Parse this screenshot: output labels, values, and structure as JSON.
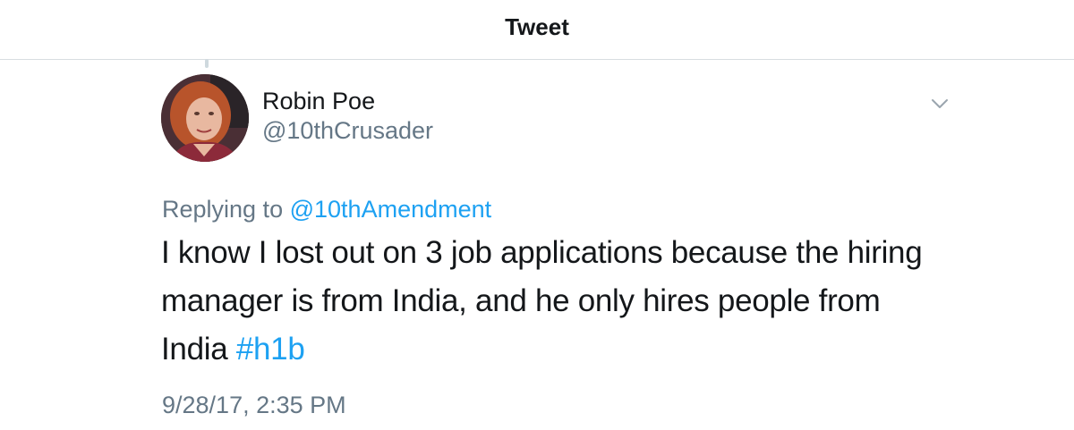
{
  "header": {
    "title": "Tweet"
  },
  "tweet": {
    "author": {
      "display_name": "Robin Poe",
      "handle": "@10thCrusader",
      "avatar_icon": "user-avatar-photo"
    },
    "menu_icon": "chevron-down-icon",
    "replying_to": {
      "prefix": "Replying to",
      "mention": "@10thAmendment"
    },
    "text_lines": [
      "I know I lost out on 3 job applications because the hiring",
      "manager is from India, and he only hires people from",
      "India"
    ],
    "hashtag": "#h1b",
    "timestamp": "9/28/17, 2:35 PM"
  },
  "colors": {
    "link": "#1da1f2",
    "secondary_text": "#657786",
    "primary_text": "#14171a",
    "divider": "#d8dde1"
  }
}
